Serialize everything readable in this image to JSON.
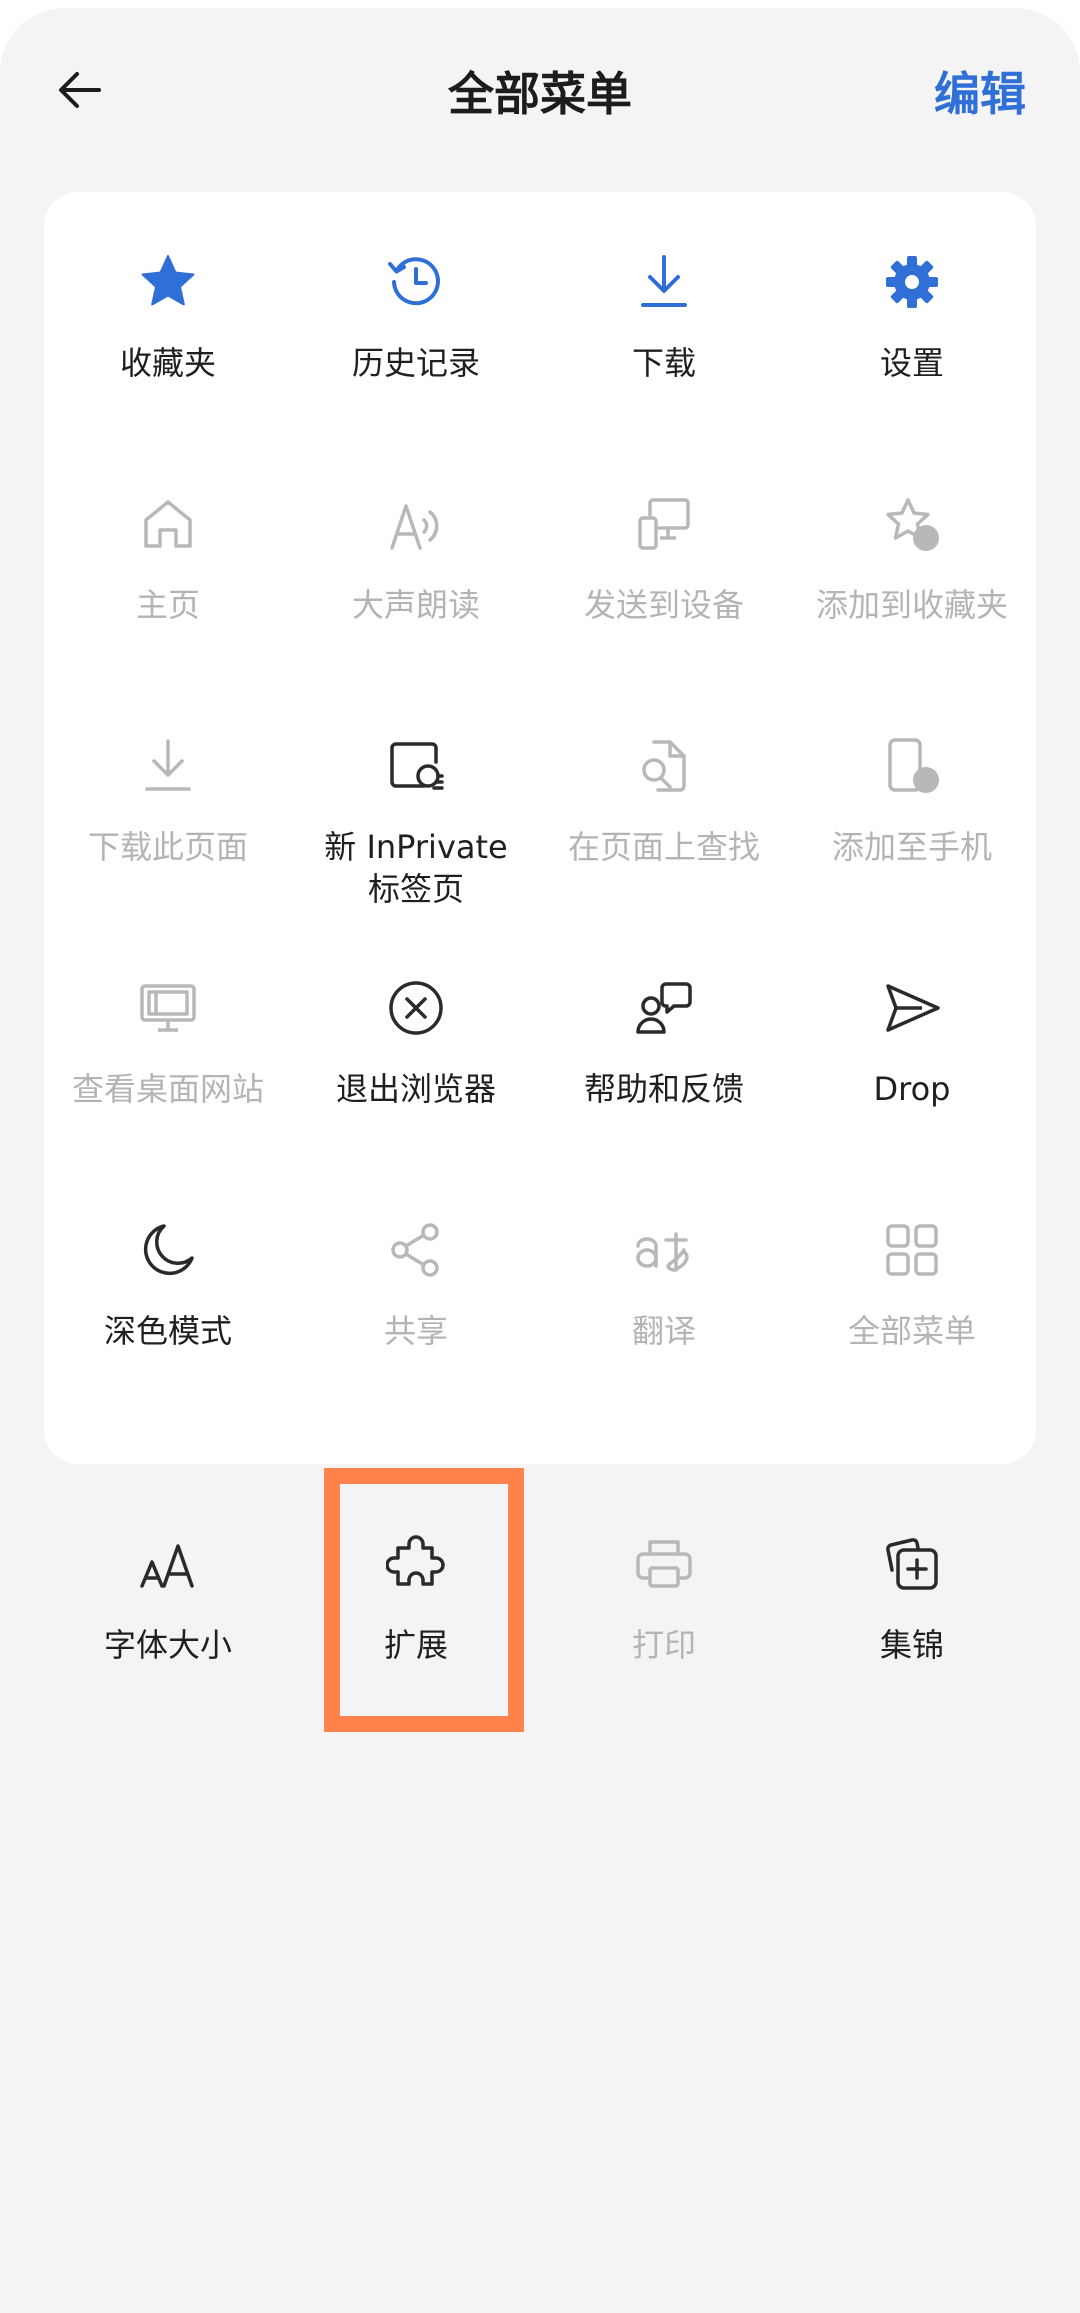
{
  "header": {
    "back_icon": "arrow-left-icon",
    "title": "全部菜单",
    "edit_label": "编辑",
    "accent_color": "#2f6fd6"
  },
  "menu": {
    "items": [
      {
        "label": "收藏夹",
        "icon": "star-icon",
        "enabled": true
      },
      {
        "label": "历史记录",
        "icon": "history-icon",
        "enabled": true
      },
      {
        "label": "下载",
        "icon": "download-icon",
        "enabled": true
      },
      {
        "label": "设置",
        "icon": "gear-icon",
        "enabled": true
      },
      {
        "label": "主页",
        "icon": "home-icon",
        "enabled": false
      },
      {
        "label": "大声朗读",
        "icon": "read-aloud-icon",
        "enabled": false
      },
      {
        "label": "发送到设备",
        "icon": "send-to-device-icon",
        "enabled": false
      },
      {
        "label": "添加到收藏夹",
        "icon": "add-favorite-icon",
        "enabled": false
      },
      {
        "label": "下载此页面",
        "icon": "download-page-icon",
        "enabled": false
      },
      {
        "label": "新 InPrivate 标签页",
        "icon": "inprivate-icon",
        "enabled": true
      },
      {
        "label": "在页面上查找",
        "icon": "find-in-page-icon",
        "enabled": false
      },
      {
        "label": "添加至手机",
        "icon": "add-to-phone-icon",
        "enabled": false
      },
      {
        "label": "查看桌面网站",
        "icon": "desktop-site-icon",
        "enabled": false
      },
      {
        "label": "退出浏览器",
        "icon": "exit-icon",
        "enabled": true
      },
      {
        "label": "帮助和反馈",
        "icon": "feedback-icon",
        "enabled": true
      },
      {
        "label": "Drop",
        "icon": "send-icon",
        "enabled": true
      },
      {
        "label": "深色模式",
        "icon": "moon-icon",
        "enabled": true
      },
      {
        "label": "共享",
        "icon": "share-icon",
        "enabled": false
      },
      {
        "label": "翻译",
        "icon": "translate-icon",
        "enabled": false
      },
      {
        "label": "全部菜单",
        "icon": "grid-icon",
        "enabled": false
      }
    ]
  },
  "extra": {
    "items": [
      {
        "label": "字体大小",
        "icon": "font-size-icon",
        "enabled": true
      },
      {
        "label": "扩展",
        "icon": "puzzle-icon",
        "enabled": true
      },
      {
        "label": "打印",
        "icon": "printer-icon",
        "enabled": false
      },
      {
        "label": "集锦",
        "icon": "collections-icon",
        "enabled": true
      }
    ]
  },
  "highlight_color": "#ff824a"
}
